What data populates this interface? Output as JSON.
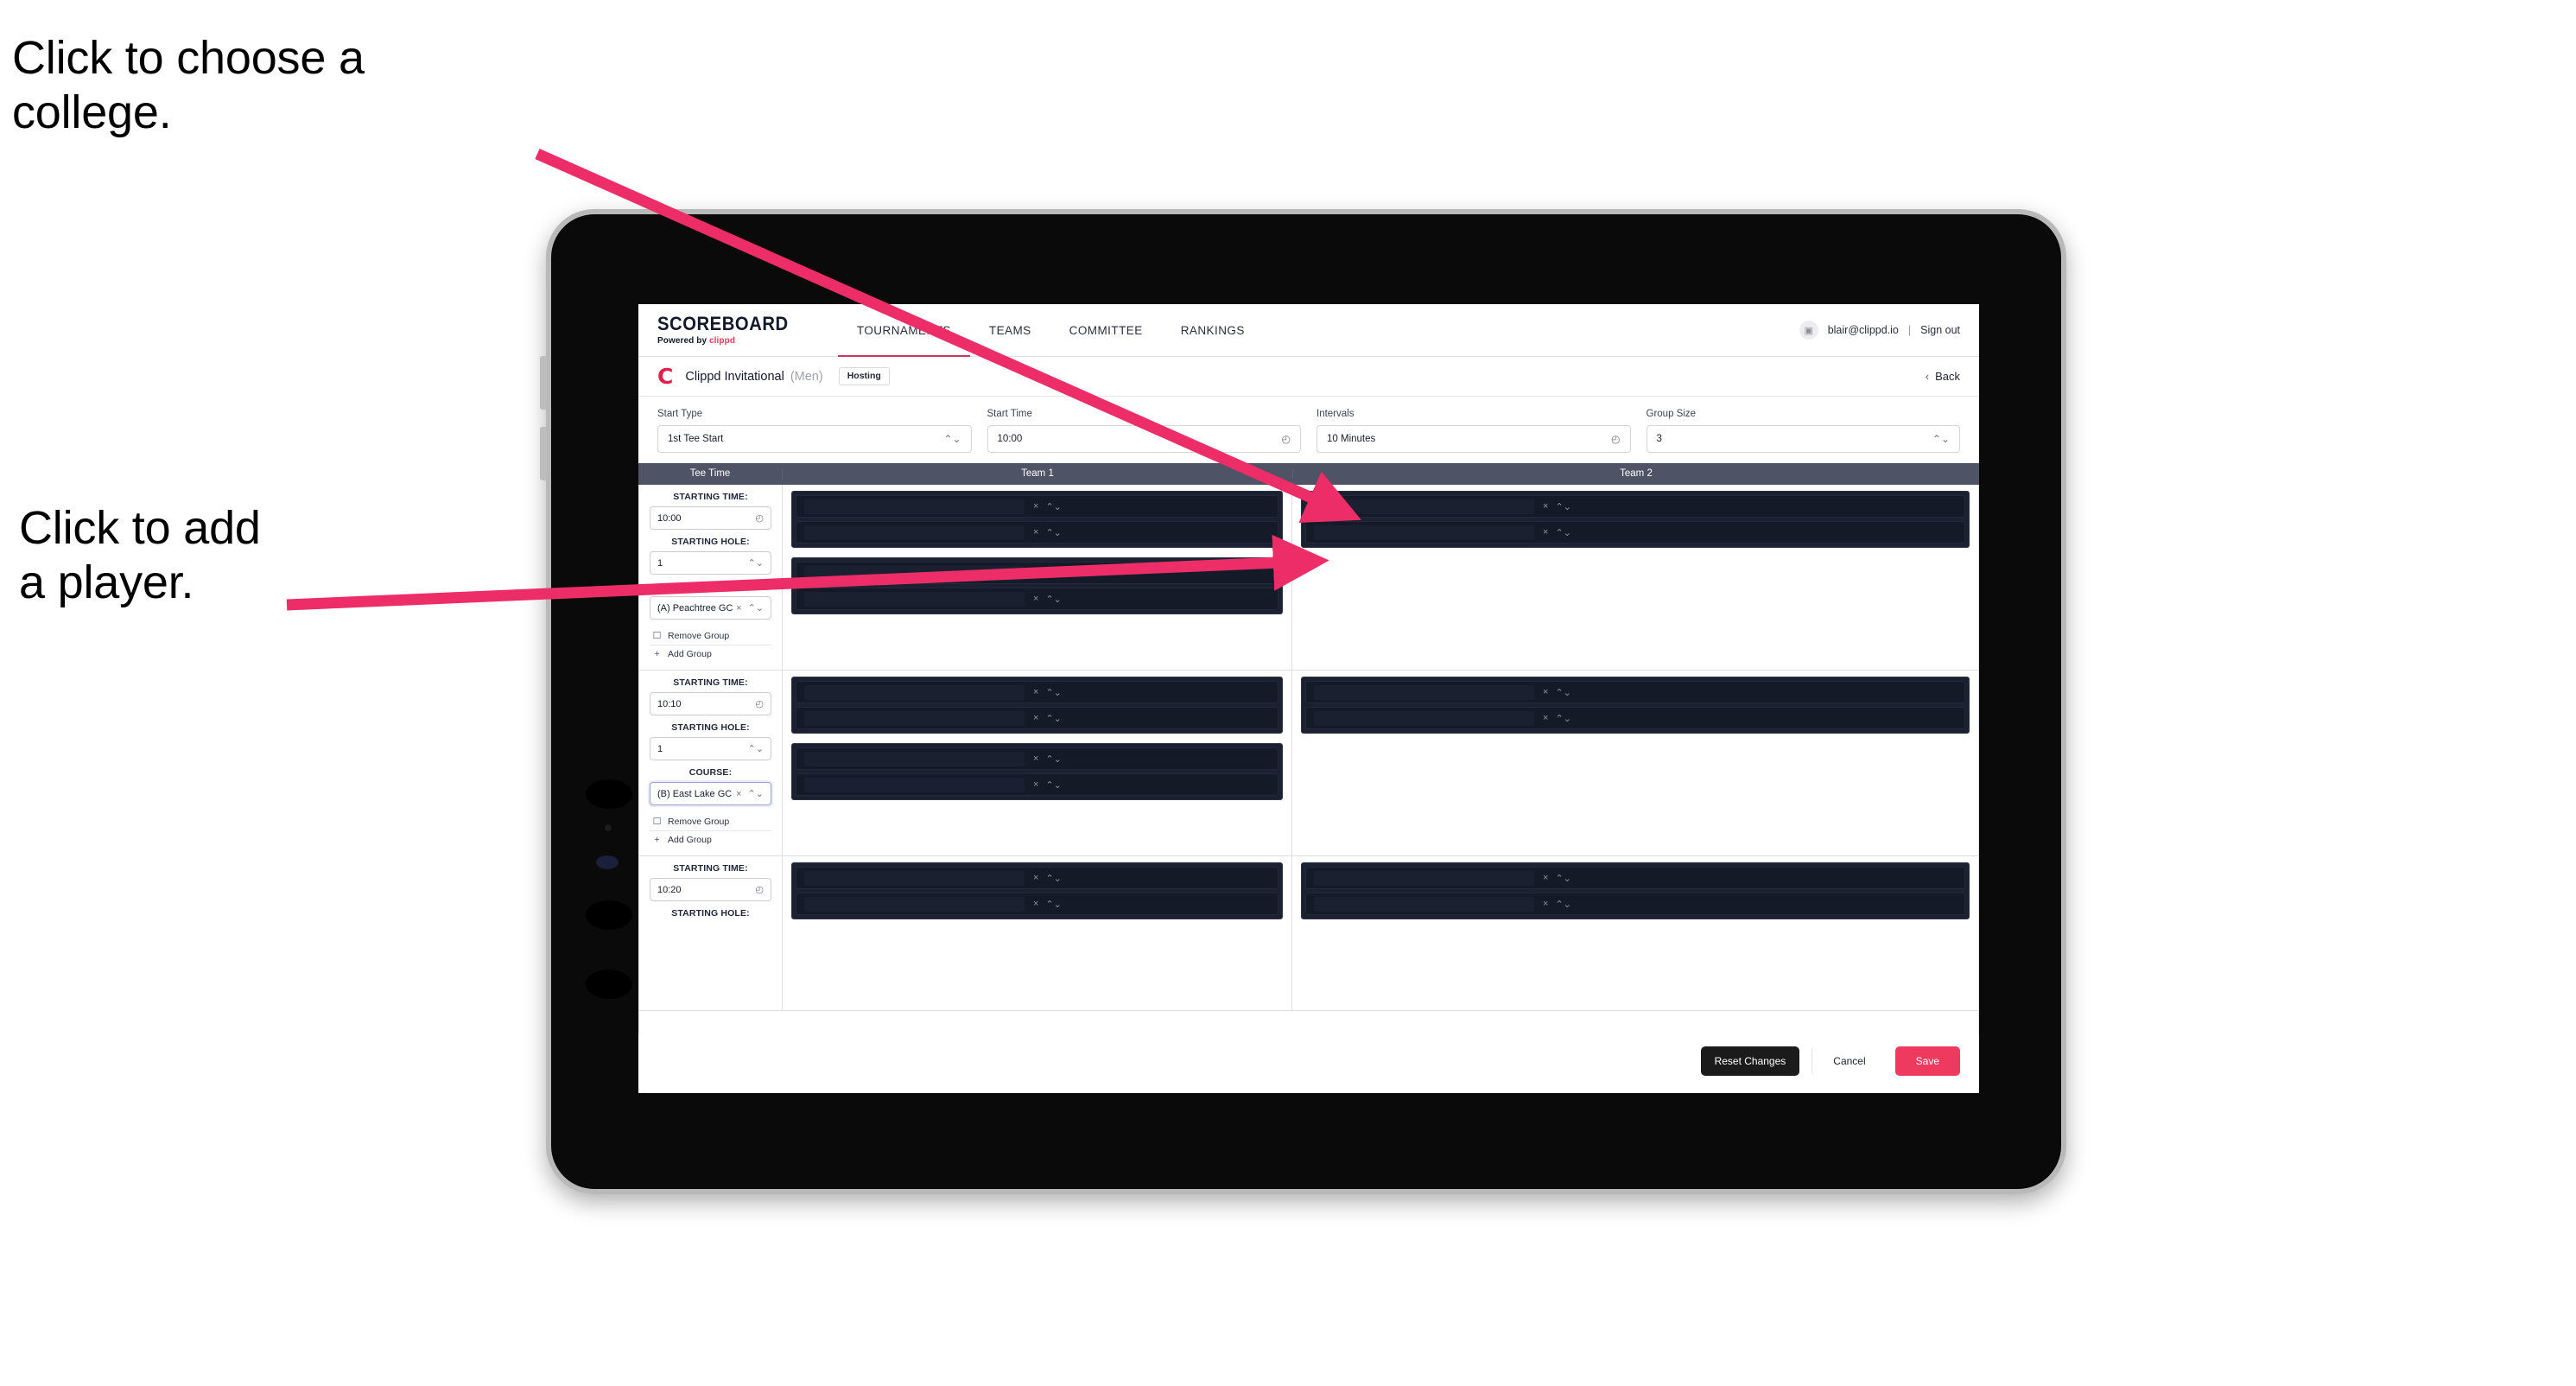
{
  "annotations": [
    {
      "id": "annot-college",
      "text": "Click to choose a\ncollege."
    },
    {
      "id": "annot-player",
      "text": "Click to add\na player."
    }
  ],
  "colors": {
    "accent_pink": "#ee3a5e",
    "brand_red": "#e01f4a",
    "table_header": "#4e5365",
    "player_panel": "#1b2130",
    "player_row": "#141a27",
    "dark_button": "#1b1b1b",
    "arrow": "#ec2d68"
  },
  "topnav": {
    "brand_title": "SCOREBOARD",
    "brand_sub_prefix": "Powered by ",
    "brand_sub_accent": "clippd",
    "tabs": [
      {
        "label": "TOURNAMENTS",
        "active": true
      },
      {
        "label": "TEAMS",
        "active": false
      },
      {
        "label": "COMMITTEE",
        "active": false
      },
      {
        "label": "RANKINGS",
        "active": false
      }
    ],
    "avatar_icon": "user-avatar-icon",
    "email": "blair@clippd.io",
    "separator": "|",
    "sign_out": "Sign out"
  },
  "subheader": {
    "logo_mark": "C",
    "tournament_name": "Clippd Invitational",
    "gender": "(Men)",
    "hosting_badge": "Hosting",
    "back_chevron": "‹",
    "back_label": "Back"
  },
  "form": {
    "fields": [
      {
        "label": "Start Type",
        "value": "1st Tee Start",
        "icon": "⌃⌄",
        "icon_name": "stepper-icon"
      },
      {
        "label": "Start Time",
        "value": "10:00",
        "icon": "◴",
        "icon_name": "clock-icon"
      },
      {
        "label": "Intervals",
        "value": "10 Minutes",
        "icon": "◴",
        "icon_name": "clock-icon"
      },
      {
        "label": "Group Size",
        "value": "3",
        "icon": "⌃⌄",
        "icon_name": "stepper-icon"
      }
    ]
  },
  "table": {
    "headers": {
      "tee_time": "Tee Time",
      "team1": "Team 1",
      "team2": "Team 2"
    },
    "labels": {
      "starting_time": "STARTING TIME:",
      "starting_hole": "STARTING HOLE:",
      "course": "COURSE:",
      "remove_group": "Remove Group",
      "add_group": "Add Group",
      "remove_icon": "☐",
      "add_icon": "+",
      "clear_icon": "×",
      "stepper_icon": "⌃⌄",
      "clock_icon": "◴"
    },
    "rows": [
      {
        "starting_time": "10:00",
        "starting_hole": "1",
        "course": "(A) Peachtree GC",
        "course_focused": false,
        "team1": [
          {
            "players": [
              "",
              ""
            ]
          },
          {
            "players": [
              "",
              ""
            ]
          }
        ],
        "team2": [
          {
            "players": [
              "",
              ""
            ]
          }
        ]
      },
      {
        "starting_time": "10:10",
        "starting_hole": "1",
        "course": "(B) East Lake GC",
        "course_focused": true,
        "team1": [
          {
            "players": [
              "",
              ""
            ]
          },
          {
            "players": [
              "",
              ""
            ]
          }
        ],
        "team2": [
          {
            "players": [
              "",
              ""
            ]
          }
        ]
      },
      {
        "starting_time": "10:20",
        "starting_hole": "",
        "course": "",
        "course_focused": false,
        "team1": [
          {
            "players": [
              "",
              ""
            ]
          }
        ],
        "team2": [
          {
            "players": [
              "",
              ""
            ]
          }
        ]
      }
    ]
  },
  "footer": {
    "reset_label": "Reset Changes",
    "cancel_label": "Cancel",
    "save_label": "Save"
  }
}
